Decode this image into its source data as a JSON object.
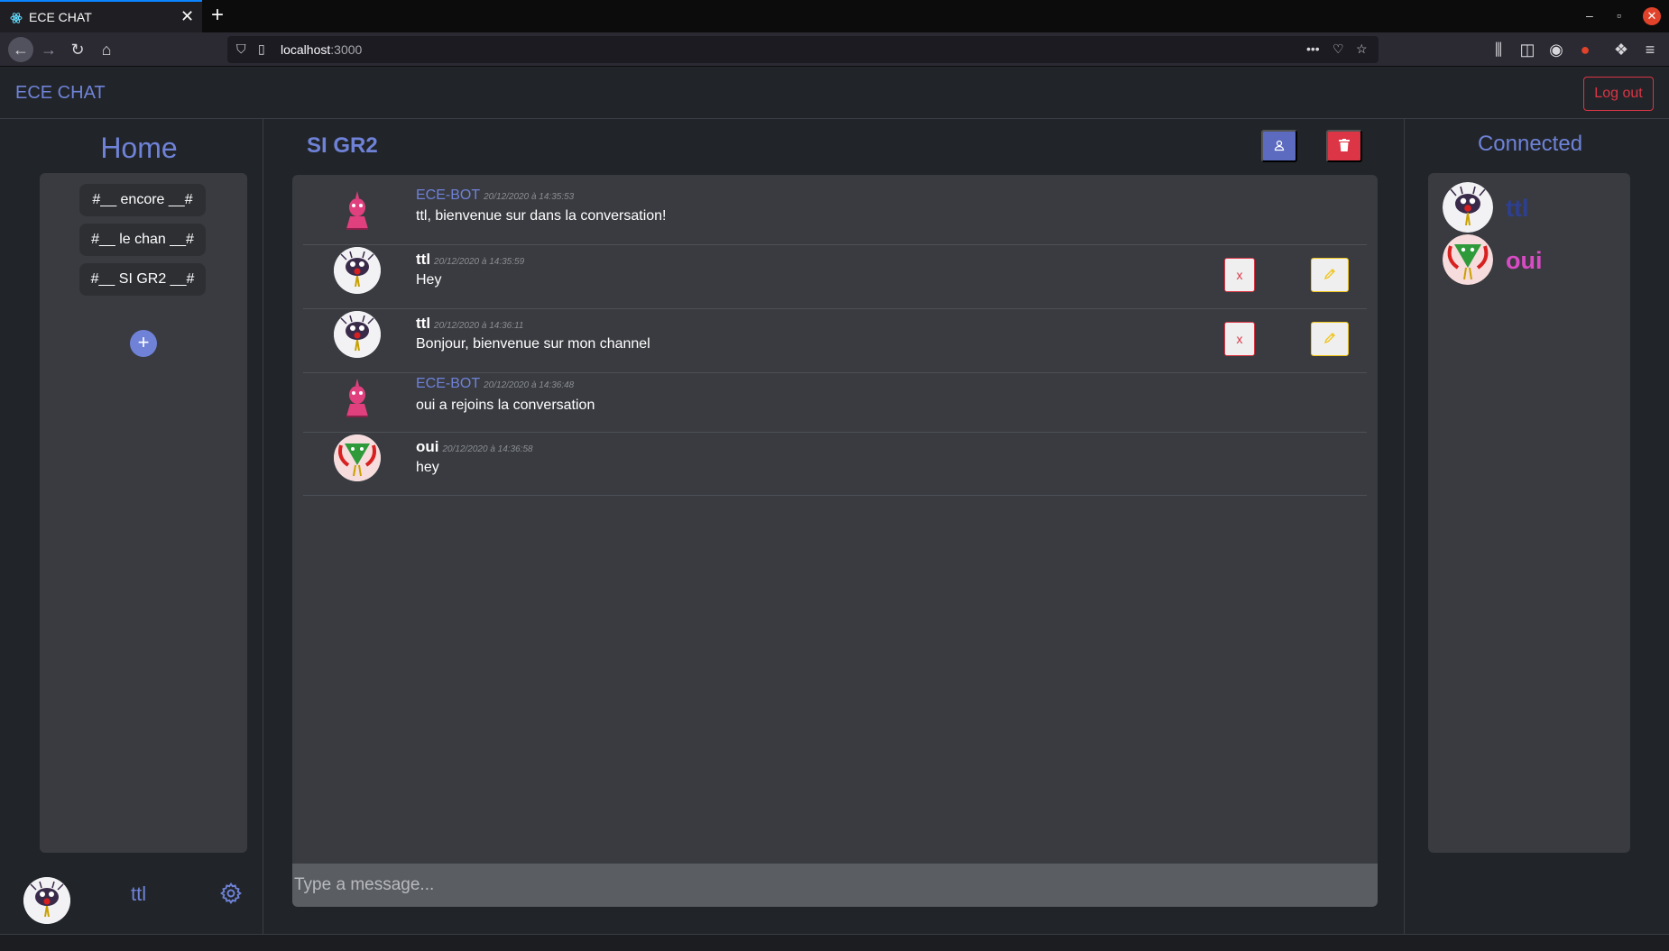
{
  "browser": {
    "tab_title": "ECE CHAT",
    "url_host": "localhost",
    "url_port": ":3000"
  },
  "app": {
    "brand": "ECE CHAT",
    "logout_label": "Log out"
  },
  "sidebar": {
    "title": "Home",
    "channels": [
      {
        "label": "#__ encore __#"
      },
      {
        "label": "#__ le chan __#"
      },
      {
        "label": "#__ SI GR2 __#"
      }
    ],
    "add_label": "+",
    "current_user": "ttl"
  },
  "channel": {
    "name": "SI GR2",
    "input_placeholder": "Type a message..."
  },
  "messages": [
    {
      "author": "ECE-BOT",
      "date": "20/12/2020 à 14:35:53",
      "text": "ttl, bienvenue sur dans la conversation!",
      "avatar": "bot-avatar"
    },
    {
      "author": "ttl",
      "date": "20/12/2020 à 14:35:59",
      "text": "Hey",
      "avatar": "bird-avatar",
      "delete_label": "x"
    },
    {
      "author": "ttl",
      "date": "20/12/2020 à 14:36:11",
      "text": "Bonjour, bienvenue sur mon channel",
      "avatar": "bird-avatar",
      "delete_label": "x"
    },
    {
      "author": "ECE-BOT",
      "date": "20/12/2020 à 14:36:48",
      "text": "oui a rejoins la conversation",
      "avatar": "bot-avatar"
    },
    {
      "author": "oui",
      "date": "20/12/2020 à 14:36:58",
      "text": "hey",
      "avatar": "frog-avatar"
    }
  ],
  "connected": {
    "title": "Connected",
    "users": [
      {
        "name": "ttl",
        "color": "#2e3f8f"
      },
      {
        "name": "oui",
        "color": "#d94bc4"
      }
    ]
  },
  "colors": {
    "accent": "#6f82d8",
    "danger": "#dc3545",
    "warning": "#f0c419"
  }
}
